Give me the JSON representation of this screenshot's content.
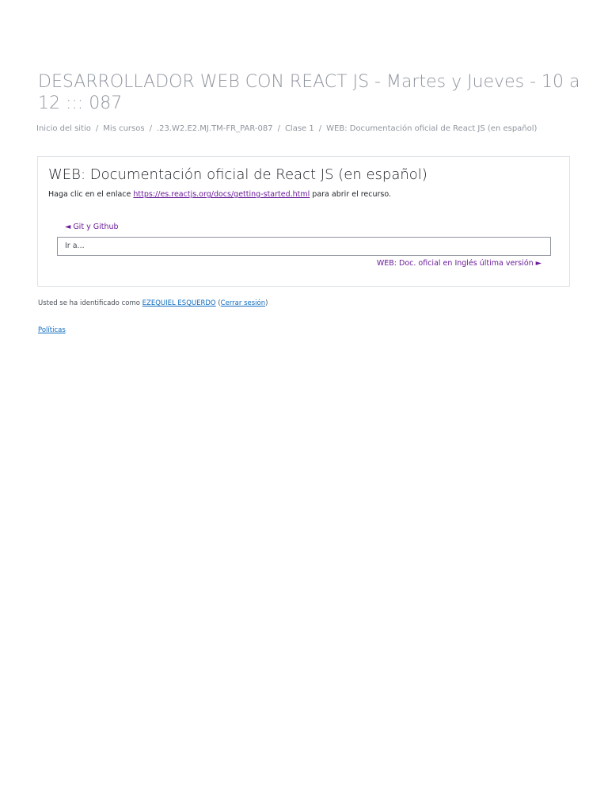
{
  "page": {
    "title": "DESARROLLADOR WEB CON REACT JS - Martes y Jueves - 10 a 12 ::: 087"
  },
  "breadcrumb": {
    "items": [
      "Inicio del sitio",
      "Mis cursos",
      ".23.W2.E2.MJ.TM-FR_PAR-087",
      "Clase 1",
      "WEB: Documentación oficial de React JS (en español)"
    ],
    "separator": "/"
  },
  "resource": {
    "title": "WEB: Documentación oficial de React JS (en español)",
    "text_before": "Haga clic en el enlace ",
    "url": "https://es.reactjs.org/docs/getting-started.html",
    "text_after": " para abrir el recurso."
  },
  "navigation": {
    "prev_label": "◄ Git y Github",
    "jump_placeholder": "Ir a...",
    "next_label": "WEB: Doc. oficial en Inglés última versión ►"
  },
  "footer": {
    "login_prefix": "Usted se ha identificado como ",
    "user_name": "EZEQUIEL ESQUERDO",
    "open_paren": " (",
    "logout_label": "Cerrar sesión",
    "close_paren": ")",
    "policies_label": "Políticas"
  },
  "colors": {
    "link_purple": "#6a1b9a",
    "link_blue": "#0f6cbf",
    "muted_text": "#8f959e"
  }
}
